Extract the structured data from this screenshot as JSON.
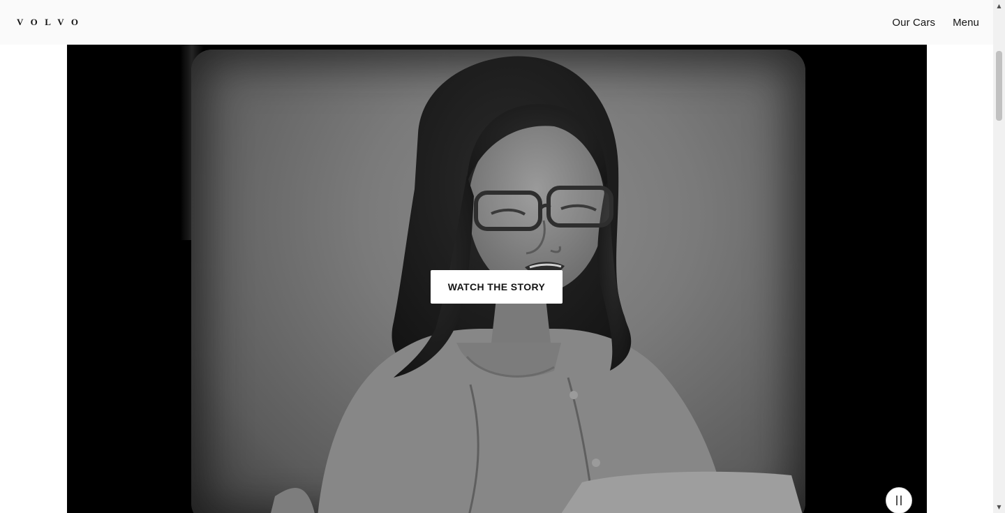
{
  "header": {
    "logo_text": "VOLVO",
    "nav": {
      "our_cars": "Our Cars",
      "menu": "Menu"
    }
  },
  "hero_video": {
    "cta_label": "WATCH THE STORY",
    "pause_icon": "pause-icon",
    "state": "playing",
    "image_description_icon": "person-portrait"
  },
  "scrollbar": {
    "up_icon": "▲",
    "down_icon": "▼"
  },
  "colors": {
    "header_bg": "#fafafa",
    "text": "#141414",
    "video_bg": "#000000",
    "button_bg": "#ffffff"
  }
}
